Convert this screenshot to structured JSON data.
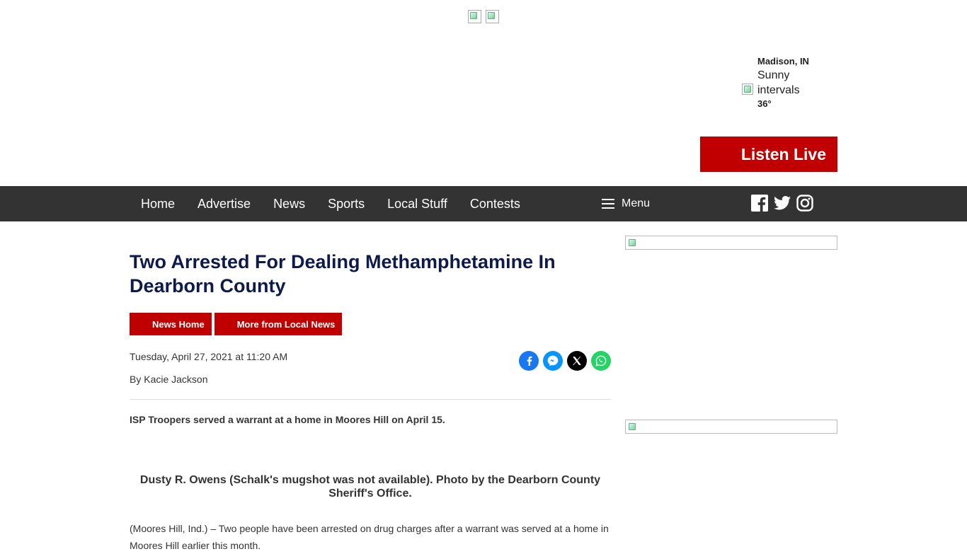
{
  "header": {
    "weather": {
      "city": "Madison, IN",
      "condition": "Sunny intervals",
      "temperature": "36°",
      "icon": "weather-icon"
    },
    "listen_live_label": "Listen Live"
  },
  "nav": {
    "items": [
      {
        "label": "Home"
      },
      {
        "label": "Advertise"
      },
      {
        "label": "News"
      },
      {
        "label": "Sports"
      },
      {
        "label": "Local Stuff"
      },
      {
        "label": "Contests"
      }
    ],
    "menu_label": "Menu",
    "social": [
      "facebook-icon",
      "twitter-icon",
      "instagram-icon"
    ]
  },
  "article": {
    "title": "Two Arrested For Dealing Methamphetamine In Dearborn County",
    "tags": [
      {
        "label": "News Home"
      },
      {
        "label": "More from Local News"
      }
    ],
    "date": "Tuesday, April 27, 2021 at 11:20 AM",
    "byline": "By Kacie Jackson",
    "share": [
      "facebook-share-icon",
      "messenger-share-icon",
      "x-share-icon",
      "whatsapp-share-icon"
    ],
    "lead": "ISP Troopers served a warrant at a home in Moores Hill on April 15.",
    "photo_caption": "Dusty R. Owens (Schalk's mugshot was not available). Photo by the Dearborn County Sheriff's Office.",
    "body_first": "(Moores Hill, Ind.) – Two people have been arrested on drug charges after a warrant was served at a home in Moores Hill earlier this month."
  },
  "colors": {
    "accent_red": "#c00000",
    "nav_bg": "#333333",
    "headline": "#0d1a4a"
  }
}
